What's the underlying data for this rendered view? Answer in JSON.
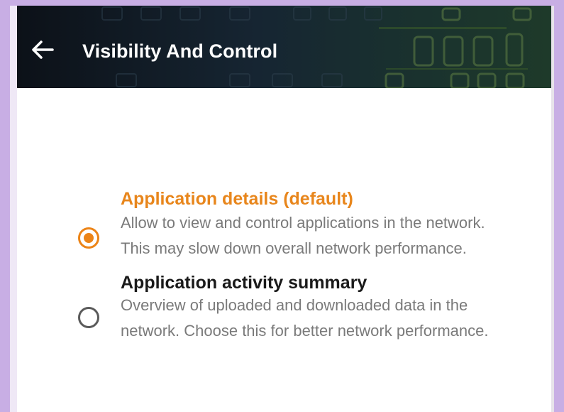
{
  "header": {
    "title": "Visibility And Control",
    "back_icon": "arrow-left-icon"
  },
  "options": [
    {
      "title": "Application details (default)",
      "description": "Allow to view and control applications in the network. This may slow down overall network performance.",
      "selected": true
    },
    {
      "title": "Application activity summary",
      "description": "Overview of uploaded and downloaded data in the network. Choose this for better network performance.",
      "selected": false
    }
  ],
  "colors": {
    "accent": "#ec8417",
    "frame": "#c8aee4",
    "header_bg": "#0c1118",
    "text_primary": "#1a1a1a",
    "text_secondary": "#7a7a7a"
  }
}
